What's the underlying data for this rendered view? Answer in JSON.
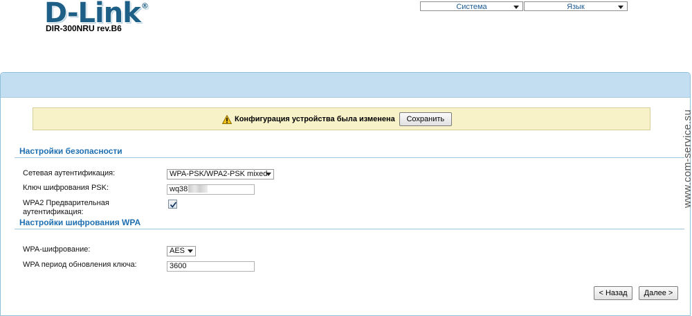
{
  "header": {
    "logo_text": "D-Link",
    "model": "DIR-300NRU rev.B6",
    "menu_system": "Система",
    "menu_language": "Язык"
  },
  "notice": {
    "icon": "warning-icon",
    "text": "Конфигурация устройства была изменена",
    "save_label": "Сохранить"
  },
  "security": {
    "title": "Настройки безопасности",
    "auth_label": "Сетевая аутентификация:",
    "auth_value": "WPA-PSK/WPA2-PSK mixed",
    "psk_label": "Ключ шифрования PSK:",
    "psk_value": "wq38",
    "preauth_label_line1": "WPA2 Предварительная",
    "preauth_label_line2": "аутентификация:",
    "preauth_checked": true
  },
  "wpa": {
    "title": "Настройки шифрования WPA",
    "cipher_label": "WPA-шифрование:",
    "cipher_value": "AES",
    "rekey_label": "WPA период обновления ключа:",
    "rekey_value": "3600"
  },
  "nav": {
    "back_label": "< Назад",
    "next_label": "Далее >"
  },
  "watermark": "www.com-service.su",
  "colors": {
    "brand": "#1d5f86",
    "section_title": "#1d6fb1",
    "panel_header": "#c2def0",
    "notice_bg": "#f7f2c8"
  }
}
